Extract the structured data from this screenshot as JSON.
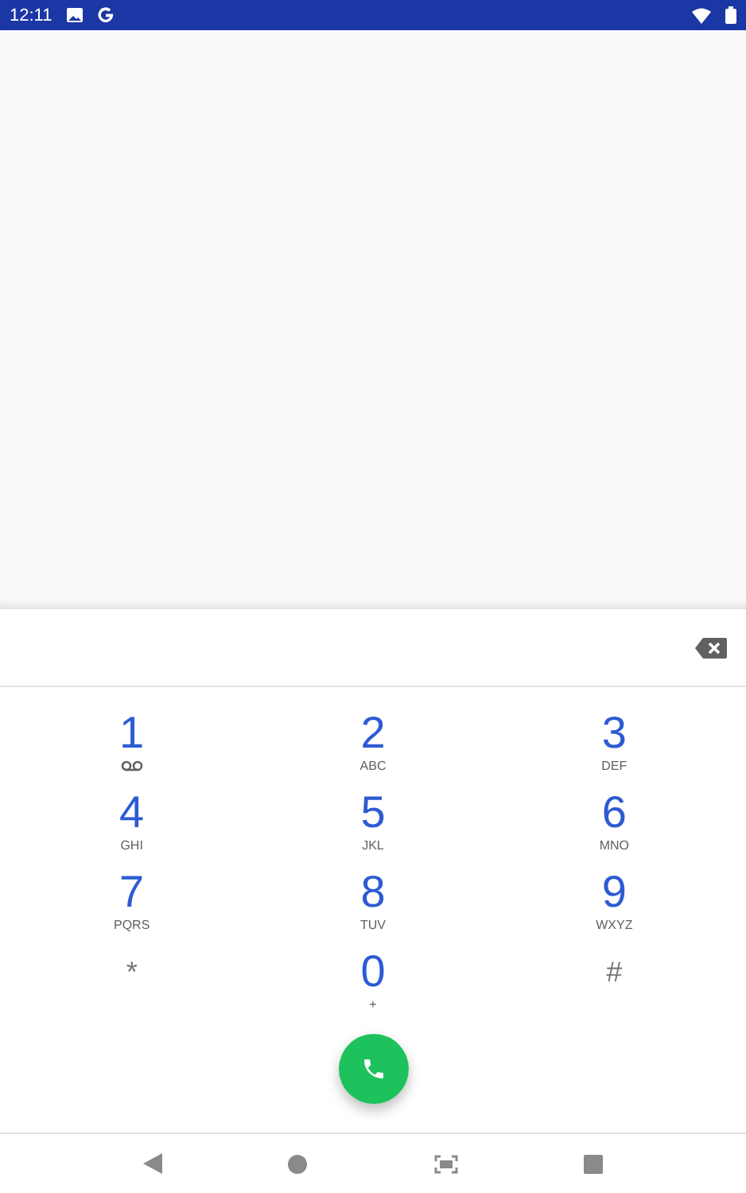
{
  "status_bar": {
    "time": "12:11"
  },
  "keypad": [
    {
      "kind": "voicemail",
      "digit": "1"
    },
    {
      "kind": "letters",
      "digit": "2",
      "letters": "ABC"
    },
    {
      "kind": "letters",
      "digit": "3",
      "letters": "DEF"
    },
    {
      "kind": "letters",
      "digit": "4",
      "letters": "GHI"
    },
    {
      "kind": "letters",
      "digit": "5",
      "letters": "JKL"
    },
    {
      "kind": "letters",
      "digit": "6",
      "letters": "MNO"
    },
    {
      "kind": "letters",
      "digit": "7",
      "letters": "PQRS"
    },
    {
      "kind": "letters",
      "digit": "8",
      "letters": "TUV"
    },
    {
      "kind": "letters",
      "digit": "9",
      "letters": "WXYZ"
    },
    {
      "kind": "symbol",
      "digit": "*"
    },
    {
      "kind": "letters",
      "digit": "0",
      "letters": "+"
    },
    {
      "kind": "symbol",
      "digit": "#"
    }
  ]
}
